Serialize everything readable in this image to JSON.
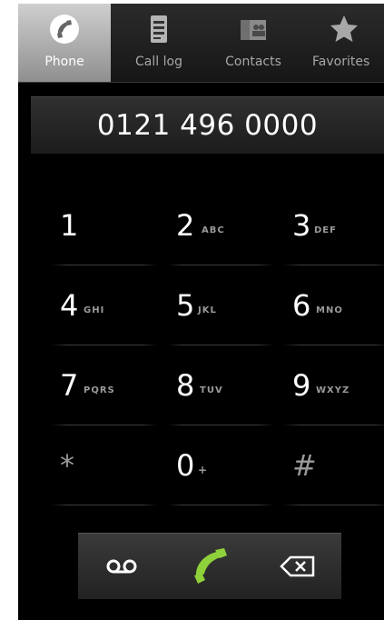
{
  "tabs": [
    {
      "label": "Phone",
      "icon": "phone-icon",
      "active": true
    },
    {
      "label": "Call log",
      "icon": "call-log-icon",
      "active": false
    },
    {
      "label": "Contacts",
      "icon": "contacts-icon",
      "active": false
    },
    {
      "label": "Favorites",
      "icon": "star-icon",
      "active": false
    }
  ],
  "display": {
    "number": "0121 496 0000"
  },
  "keypad": [
    {
      "digit": "1",
      "letters": ""
    },
    {
      "digit": "2",
      "letters": "ABC"
    },
    {
      "digit": "3",
      "letters": "DEF"
    },
    {
      "digit": "4",
      "letters": "GHI"
    },
    {
      "digit": "5",
      "letters": "JKL"
    },
    {
      "digit": "6",
      "letters": "MNO"
    },
    {
      "digit": "7",
      "letters": "PQRS"
    },
    {
      "digit": "8",
      "letters": "TUV"
    },
    {
      "digit": "9",
      "letters": "WXYZ"
    },
    {
      "digit": "*",
      "letters": ""
    },
    {
      "digit": "0",
      "letters": "+"
    },
    {
      "digit": "#",
      "letters": ""
    }
  ],
  "actions": {
    "voicemail_icon": "voicemail-icon",
    "call_icon": "call-icon",
    "delete_icon": "backspace-icon"
  },
  "colors": {
    "call_green": "#8fd13a",
    "active_tab": "#b0b0b0",
    "background": "#000000"
  }
}
